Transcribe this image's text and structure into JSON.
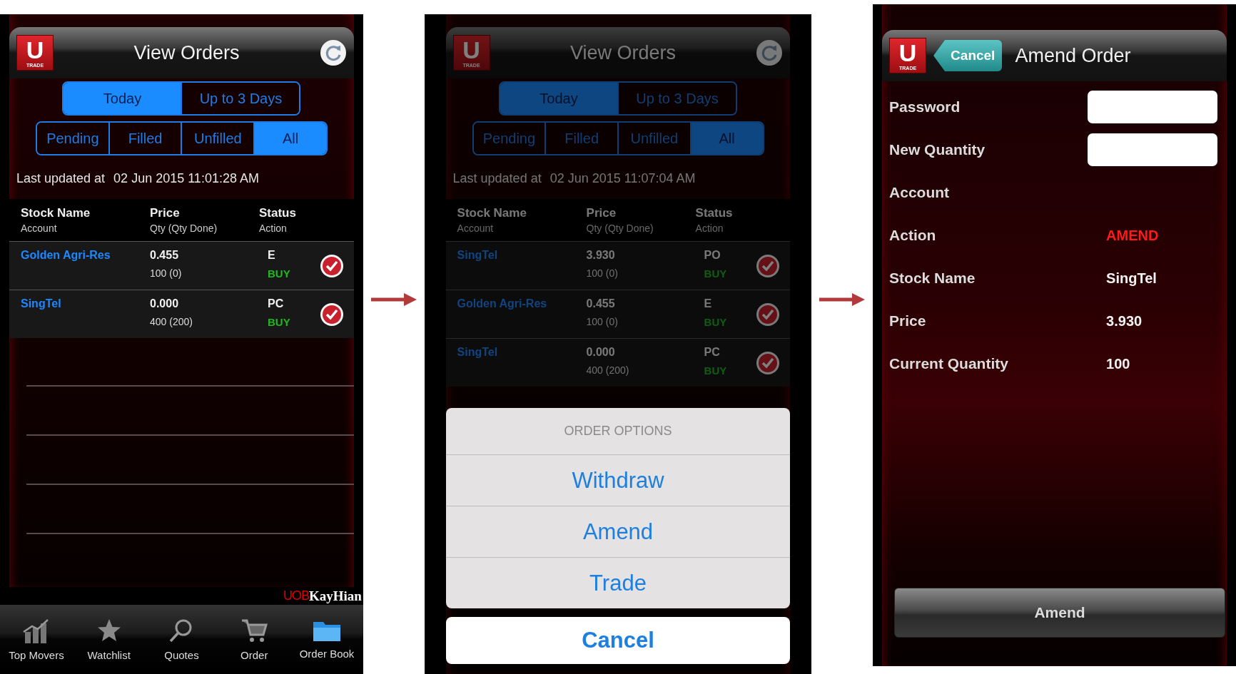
{
  "screens": [
    {
      "kind": "orders",
      "dimmed": false,
      "logo": {
        "letter": "U",
        "caption": "TRADE"
      },
      "title": "View Orders",
      "periods": [
        {
          "label": "Today",
          "selected": true
        },
        {
          "label": "Up to 3 Days",
          "selected": false
        }
      ],
      "filters": [
        {
          "label": "Pending",
          "selected": false
        },
        {
          "label": "Filled",
          "selected": false
        },
        {
          "label": "Unfilled",
          "selected": false
        },
        {
          "label": "All",
          "selected": true
        }
      ],
      "last_updated_label": "Last updated at",
      "last_updated": "02 Jun 2015 11:01:28 AM",
      "columns": [
        {
          "title": "Stock Name",
          "subtitle": "Account"
        },
        {
          "title": "Price",
          "subtitle": "Qty (Qty Done)"
        },
        {
          "title": "Status",
          "subtitle": "Action"
        }
      ],
      "rows": [
        {
          "stock": "Golden Agri-Res",
          "price": "0.455",
          "qty": "100 (0)",
          "status": "E",
          "action": "BUY"
        },
        {
          "stock": "SingTel",
          "price": "0.000",
          "qty": "400 (200)",
          "status": "PC",
          "action": "BUY"
        }
      ],
      "brand": {
        "mark": "UOB",
        "name": "KayHian"
      },
      "tab_bar": [
        {
          "label": "Top Movers"
        },
        {
          "label": "Watchlist"
        },
        {
          "label": "Quotes"
        },
        {
          "label": "Order"
        },
        {
          "label": "Order Book"
        }
      ]
    },
    {
      "kind": "orders",
      "dimmed": true,
      "logo": {
        "letter": "U",
        "caption": "TRADE"
      },
      "title": "View Orders",
      "periods": [
        {
          "label": "Today",
          "selected": true
        },
        {
          "label": "Up to 3 Days",
          "selected": false
        }
      ],
      "filters": [
        {
          "label": "Pending",
          "selected": false
        },
        {
          "label": "Filled",
          "selected": false
        },
        {
          "label": "Unfilled",
          "selected": false
        },
        {
          "label": "All",
          "selected": true
        }
      ],
      "last_updated_label": "Last updated at",
      "last_updated": "02 Jun 2015 11:07:04 AM",
      "columns": [
        {
          "title": "Stock Name",
          "subtitle": "Account"
        },
        {
          "title": "Price",
          "subtitle": "Qty (Qty Done)"
        },
        {
          "title": "Status",
          "subtitle": "Action"
        }
      ],
      "rows": [
        {
          "stock": "SingTel",
          "price": "3.930",
          "qty": "100 (0)",
          "status": "PO",
          "action": "BUY"
        },
        {
          "stock": "Golden Agri-Res",
          "price": "0.455",
          "qty": "100 (0)",
          "status": "E",
          "action": "BUY"
        },
        {
          "stock": "SingTel",
          "price": "0.000",
          "qty": "400 (200)",
          "status": "PC",
          "action": "BUY"
        }
      ],
      "action_sheet": {
        "title": "ORDER OPTIONS",
        "options": [
          "Withdraw",
          "Amend",
          "Trade"
        ],
        "cancel": "Cancel"
      }
    },
    {
      "kind": "amend",
      "logo": {
        "letter": "U",
        "caption": "TRADE"
      },
      "back": "Cancel",
      "title": "Amend Order",
      "fields": [
        {
          "kind": "input",
          "label": "Password"
        },
        {
          "kind": "input",
          "label": "New Quantity"
        },
        {
          "kind": "value",
          "label": "Account"
        },
        {
          "kind": "value",
          "label": "Action",
          "value": "AMEND",
          "highlight": true
        },
        {
          "kind": "value",
          "label": "Stock Name",
          "value": "SingTel",
          "highlight": false
        },
        {
          "kind": "value",
          "label": "Price",
          "value": "3.930",
          "highlight": false
        },
        {
          "kind": "value",
          "label": "Current Quantity",
          "value": "100",
          "highlight": false
        }
      ],
      "submit": "Amend"
    }
  ]
}
